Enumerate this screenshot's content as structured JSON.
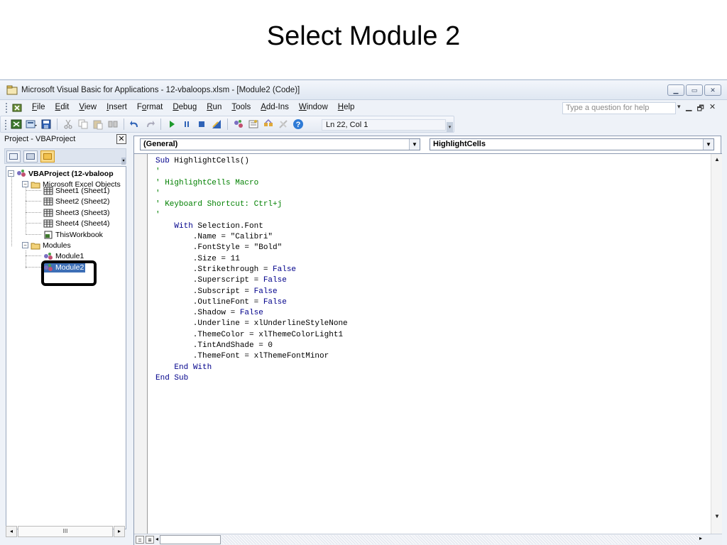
{
  "slide": {
    "title": "Select Module 2"
  },
  "window": {
    "title": "Microsoft Visual Basic for Applications - 12-vbaloops.xlsm - [Module2 (Code)]",
    "buttons": [
      "minimize-icon",
      "maximize-icon",
      "close-icon"
    ]
  },
  "menu": {
    "items": [
      {
        "label": "File",
        "u": "F",
        "rest": "ile"
      },
      {
        "label": "Edit",
        "u": "E",
        "rest": "dit"
      },
      {
        "label": "View",
        "u": "V",
        "rest": "iew"
      },
      {
        "label": "Insert",
        "u": "I",
        "rest": "nsert"
      },
      {
        "label": "Format",
        "pre": "F",
        "u": "o",
        "rest": "rmat"
      },
      {
        "label": "Debug",
        "u": "D",
        "rest": "ebug"
      },
      {
        "label": "Run",
        "u": "R",
        "rest": "un"
      },
      {
        "label": "Tools",
        "u": "T",
        "rest": "ools"
      },
      {
        "label": "Add-Ins",
        "u": "A",
        "rest": "dd-Ins"
      },
      {
        "label": "Window",
        "u": "W",
        "rest": "indow"
      },
      {
        "label": "Help",
        "u": "H",
        "rest": "elp"
      }
    ],
    "help_placeholder": "Type a question for help"
  },
  "toolbar": {
    "position": "Ln 22, Col 1",
    "icons": [
      "view-excel-icon",
      "insert-module-icon",
      "save-icon",
      "cut-icon",
      "copy-icon",
      "paste-icon",
      "find-icon",
      "undo-icon",
      "redo-icon",
      "run-icon",
      "break-icon",
      "reset-icon",
      "design-mode-icon",
      "project-explorer-icon",
      "properties-icon",
      "object-browser-icon",
      "toolbox-icon",
      "help-icon"
    ]
  },
  "project": {
    "header": "Project - VBAProject",
    "tree": {
      "root": "VBAProject (12-vbaloop",
      "excel_objects": "Microsoft Excel Objects",
      "sheets": [
        "Sheet1 (Sheet1)",
        "Sheet2 (Sheet2)",
        "Sheet3 (Sheet3)",
        "Sheet4 (Sheet4)",
        "ThisWorkbook"
      ],
      "modules_folder": "Modules",
      "modules": [
        "Module1",
        "Module2"
      ]
    },
    "scroll_label": "III"
  },
  "code": {
    "object_dropdown": "(General)",
    "procedure_dropdown": "HighlightCells",
    "lines": [
      "Sub HighlightCells()",
      "'",
      "' HighlightCells Macro",
      "'",
      "' Keyboard Shortcut: Ctrl+j",
      "'",
      "    With Selection.Font",
      "        .Name = \"Calibri\"",
      "        .FontStyle = \"Bold\"",
      "        .Size = 11",
      "        .Strikethrough = False",
      "        .Superscript = False",
      "        .Subscript = False",
      "        .OutlineFont = False",
      "        .Shadow = False",
      "        .Underline = xlUnderlineStyleNone",
      "        .ThemeColor = xlThemeColorLight1",
      "        .TintAndShade = 0",
      "        .ThemeFont = xlThemeFontMinor",
      "    End With",
      "End Sub"
    ]
  }
}
